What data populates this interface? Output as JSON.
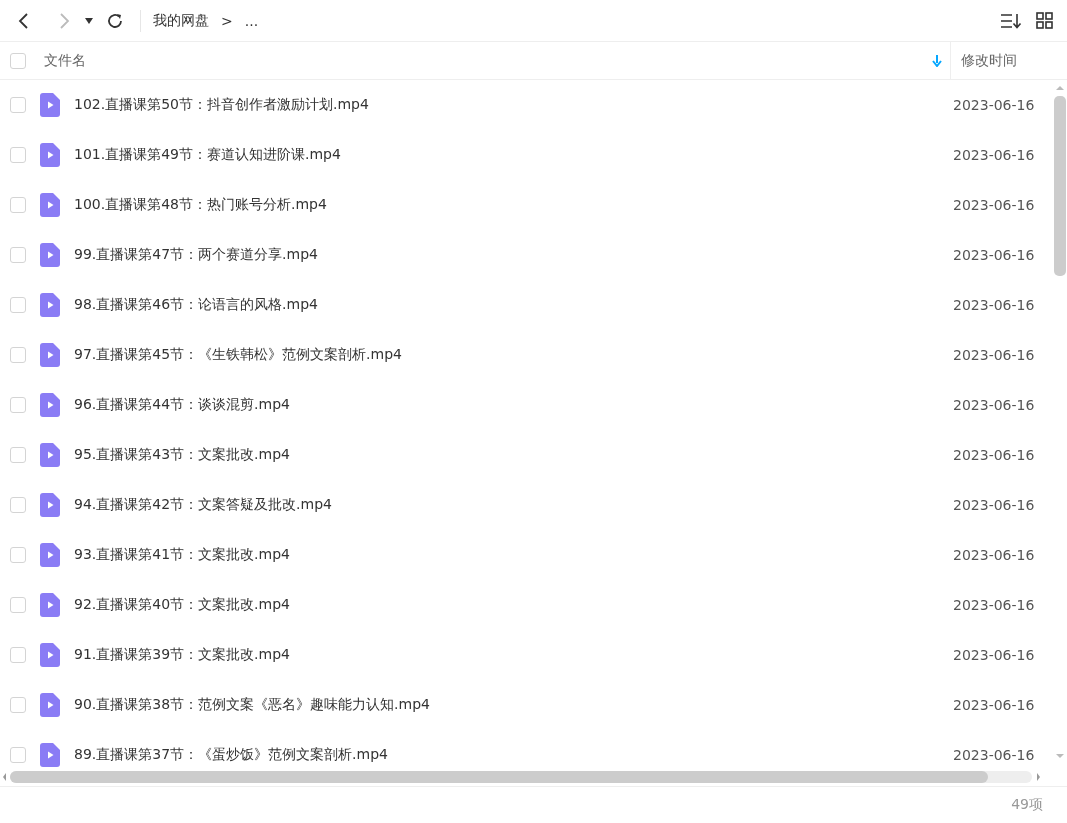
{
  "toolbar": {
    "breadcrumb": [
      {
        "label": "我的网盘"
      },
      {
        "label": "..."
      }
    ],
    "separator": ">"
  },
  "table": {
    "header": {
      "checked": false,
      "columns": [
        "文件名",
        "修改时间"
      ]
    },
    "rows": [
      {
        "name": "102.直播课第50节：抖音创作者激励计划.mp4",
        "date": "2023-06-16",
        "checked": false
      },
      {
        "name": "101.直播课第49节：赛道认知进阶课.mp4",
        "date": "2023-06-16",
        "checked": false
      },
      {
        "name": "100.直播课第48节：热门账号分析.mp4",
        "date": "2023-06-16",
        "checked": false
      },
      {
        "name": "99.直播课第47节：两个赛道分享.mp4",
        "date": "2023-06-16",
        "checked": false
      },
      {
        "name": "98.直播课第46节：论语言的风格.mp4",
        "date": "2023-06-16",
        "checked": false
      },
      {
        "name": "97.直播课第45节：《生铁韩松》范例文案剖析.mp4",
        "date": "2023-06-16",
        "checked": false
      },
      {
        "name": "96.直播课第44节：谈谈混剪.mp4",
        "date": "2023-06-16",
        "checked": false
      },
      {
        "name": "95.直播课第43节：文案批改.mp4",
        "date": "2023-06-16",
        "checked": false
      },
      {
        "name": "94.直播课第42节：文案答疑及批改.mp4",
        "date": "2023-06-16",
        "checked": false
      },
      {
        "name": "93.直播课第41节：文案批改.mp4",
        "date": "2023-06-16",
        "checked": false
      },
      {
        "name": "92.直播课第40节：文案批改.mp4",
        "date": "2023-06-16",
        "checked": false
      },
      {
        "name": "91.直播课第39节：文案批改.mp4",
        "date": "2023-06-16",
        "checked": false
      },
      {
        "name": "90.直播课第38节：范例文案《恶名》趣味能力认知.mp4",
        "date": "2023-06-16",
        "checked": false
      },
      {
        "name": "89.直播课第37节：《蛋炒饭》范例文案剖析.mp4",
        "date": "2023-06-16",
        "checked": false
      }
    ]
  },
  "status_bar": {
    "count": "49项"
  }
}
